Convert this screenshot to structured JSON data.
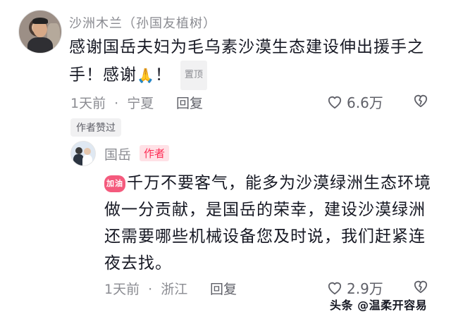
{
  "comment1": {
    "username": "沙洲木兰（孙国友植树）",
    "text": "感谢国岳夫妇为毛乌素沙漠生态建设伸出援手之手！感谢",
    "emoji": "🙏",
    "text_tail": "！",
    "pinned_label": "置顶",
    "time": "1天前",
    "separator": "·",
    "location": "宁夏",
    "reply_label": "回复",
    "likes": "6.6万",
    "author_liked_label": "作者赞过"
  },
  "comment2": {
    "username": "国岳",
    "author_badge": "作者",
    "cheer_sticker": "加油",
    "text": "千万不要客气，能多为沙漠绿洲生态环境做一分贡献，是国岳的荣幸，建设沙漠绿洲还需要哪些机械设备您及时说，我们赶紧连夜去找。",
    "time": "1天前",
    "separator": "·",
    "location": "浙江",
    "reply_label": "回复",
    "likes": "2.9万"
  },
  "watermark": "头条 @温柔开容易",
  "colors": {
    "accent": "#fe2c55",
    "meta": "#8a8b91",
    "text": "#161823"
  },
  "icons": [
    "heart-icon",
    "broken-heart-icon",
    "cheer-sticker-icon"
  ]
}
